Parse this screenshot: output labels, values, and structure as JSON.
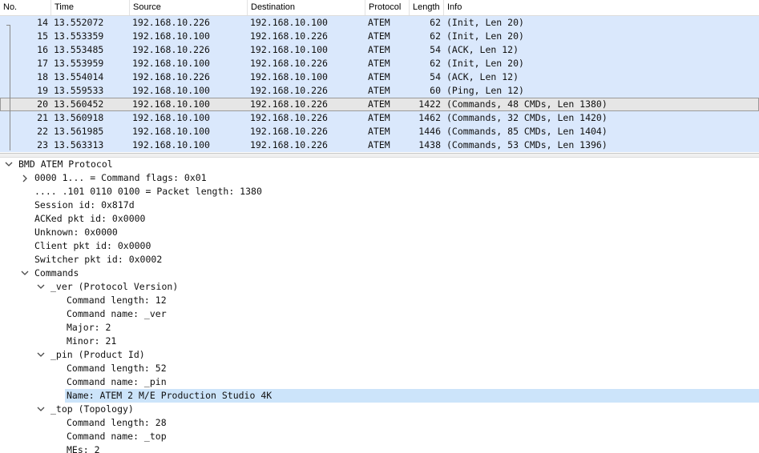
{
  "packet_list": {
    "columns": [
      "No.",
      "Time",
      "Source",
      "Destination",
      "Protocol",
      "Length",
      "Info"
    ],
    "rows": [
      {
        "no": "14",
        "time": "13.552072",
        "source": "192.168.10.226",
        "destination": "192.168.10.100",
        "protocol": "ATEM",
        "length": "62",
        "info": "(Init, Len 20)"
      },
      {
        "no": "15",
        "time": "13.553359",
        "source": "192.168.10.100",
        "destination": "192.168.10.226",
        "protocol": "ATEM",
        "length": "62",
        "info": "(Init, Len 20)"
      },
      {
        "no": "16",
        "time": "13.553485",
        "source": "192.168.10.226",
        "destination": "192.168.10.100",
        "protocol": "ATEM",
        "length": "54",
        "info": "(ACK, Len 12)"
      },
      {
        "no": "17",
        "time": "13.553959",
        "source": "192.168.10.100",
        "destination": "192.168.10.226",
        "protocol": "ATEM",
        "length": "62",
        "info": "(Init, Len 20)"
      },
      {
        "no": "18",
        "time": "13.554014",
        "source": "192.168.10.226",
        "destination": "192.168.10.100",
        "protocol": "ATEM",
        "length": "54",
        "info": "(ACK, Len 12)"
      },
      {
        "no": "19",
        "time": "13.559533",
        "source": "192.168.10.100",
        "destination": "192.168.10.226",
        "protocol": "ATEM",
        "length": "60",
        "info": "(Ping, Len 12)"
      },
      {
        "no": "20",
        "time": "13.560452",
        "source": "192.168.10.100",
        "destination": "192.168.10.226",
        "protocol": "ATEM",
        "length": "1422",
        "info": "(Commands, 48 CMDs, Len 1380)"
      },
      {
        "no": "21",
        "time": "13.560918",
        "source": "192.168.10.100",
        "destination": "192.168.10.226",
        "protocol": "ATEM",
        "length": "1462",
        "info": "(Commands, 32 CMDs, Len 1420)"
      },
      {
        "no": "22",
        "time": "13.561985",
        "source": "192.168.10.100",
        "destination": "192.168.10.226",
        "protocol": "ATEM",
        "length": "1446",
        "info": "(Commands, 85 CMDs, Len 1404)"
      },
      {
        "no": "23",
        "time": "13.563313",
        "source": "192.168.10.100",
        "destination": "192.168.10.226",
        "protocol": "ATEM",
        "length": "1438",
        "info": "(Commands, 53 CMDs, Len 1396)"
      }
    ],
    "selected_no": "20"
  },
  "details": {
    "nodes": [
      {
        "text": "BMD ATEM Protocol",
        "twisty": "expanded",
        "depth": 0
      },
      {
        "text": "0000 1... = Command flags: 0x01",
        "twisty": "collapsed",
        "depth": 1
      },
      {
        "text": ".... .101 0110 0100 = Packet length: 1380",
        "twisty": "none",
        "depth": 1
      },
      {
        "text": "Session id: 0x817d",
        "twisty": "none",
        "depth": 1
      },
      {
        "text": "ACKed pkt id: 0x0000",
        "twisty": "none",
        "depth": 1
      },
      {
        "text": "Unknown: 0x0000",
        "twisty": "none",
        "depth": 1
      },
      {
        "text": "Client pkt id: 0x0000",
        "twisty": "none",
        "depth": 1
      },
      {
        "text": "Switcher pkt id: 0x0002",
        "twisty": "none",
        "depth": 1
      },
      {
        "text": "Commands",
        "twisty": "expanded",
        "depth": 1
      },
      {
        "text": "_ver (Protocol Version)",
        "twisty": "expanded",
        "depth": 2
      },
      {
        "text": "Command length: 12",
        "twisty": "none",
        "depth": 3
      },
      {
        "text": "Command name: _ver",
        "twisty": "none",
        "depth": 3
      },
      {
        "text": "Major: 2",
        "twisty": "none",
        "depth": 3
      },
      {
        "text": "Minor: 21",
        "twisty": "none",
        "depth": 3
      },
      {
        "text": "_pin (Product Id)",
        "twisty": "expanded",
        "depth": 2
      },
      {
        "text": "Command length: 52",
        "twisty": "none",
        "depth": 3
      },
      {
        "text": "Command name: _pin",
        "twisty": "none",
        "depth": 3
      },
      {
        "text": "Name: ATEM 2 M/E Production Studio 4K",
        "twisty": "none",
        "depth": 3,
        "highlighted": true
      },
      {
        "text": "_top (Topology)",
        "twisty": "expanded",
        "depth": 2
      },
      {
        "text": "Command length: 28",
        "twisty": "none",
        "depth": 3
      },
      {
        "text": "Command name: _top",
        "twisty": "none",
        "depth": 3
      },
      {
        "text": "MEs: 2",
        "twisty": "none",
        "depth": 3
      }
    ]
  },
  "icons": {
    "expanded": "chevron-down-icon",
    "collapsed": "chevron-right-icon"
  },
  "colors": {
    "row_bg": "#dae8fc",
    "selected_row_bg": "#e6e6e6",
    "highlight_bg": "#cce4fa"
  }
}
